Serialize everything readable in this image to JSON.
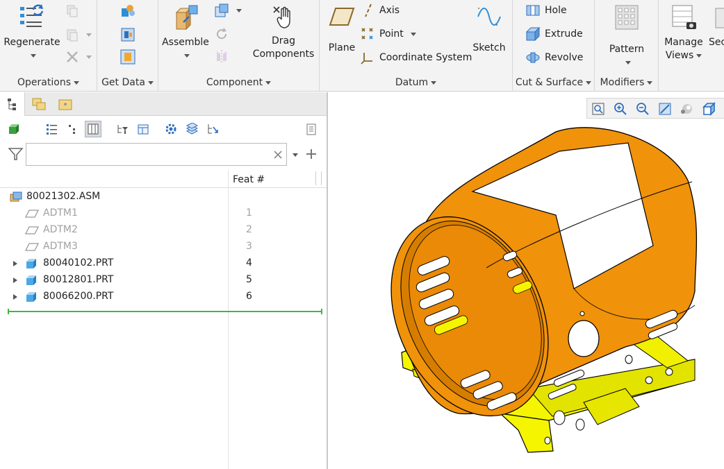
{
  "ribbon": {
    "operations": {
      "regenerate": "Regenerate",
      "label": "Operations"
    },
    "get_data": {
      "label": "Get Data"
    },
    "component": {
      "assemble": "Assemble",
      "drag1": "Drag",
      "drag2": "Components",
      "label": "Component"
    },
    "datum": {
      "plane": "Plane",
      "axis": "Axis",
      "point": "Point",
      "csys": "Coordinate System",
      "sketch": "Sketch",
      "label": "Datum"
    },
    "cut_surface": {
      "hole": "Hole",
      "extrude": "Extrude",
      "revolve": "Revolve",
      "label": "Cut & Surface"
    },
    "modifiers": {
      "pattern": "Pattern",
      "label": "Modifiers"
    },
    "views": {
      "manage1": "Manage",
      "manage2": "Views",
      "sec": "Sec"
    }
  },
  "tree": {
    "filter_placeholder": "",
    "column_header": "Feat #",
    "root": "80021302.ASM",
    "rows": [
      {
        "label": "ADTM1",
        "num": "1"
      },
      {
        "label": "ADTM2",
        "num": "2"
      },
      {
        "label": "ADTM3",
        "num": "3"
      },
      {
        "label": "80040102.PRT",
        "num": "4"
      },
      {
        "label": "80012801.PRT",
        "num": "5"
      },
      {
        "label": "80066200.PRT",
        "num": "6"
      }
    ]
  },
  "colors": {
    "housing": "#f0920a",
    "base": "#f5f500",
    "accent": "#2d8fd8"
  }
}
